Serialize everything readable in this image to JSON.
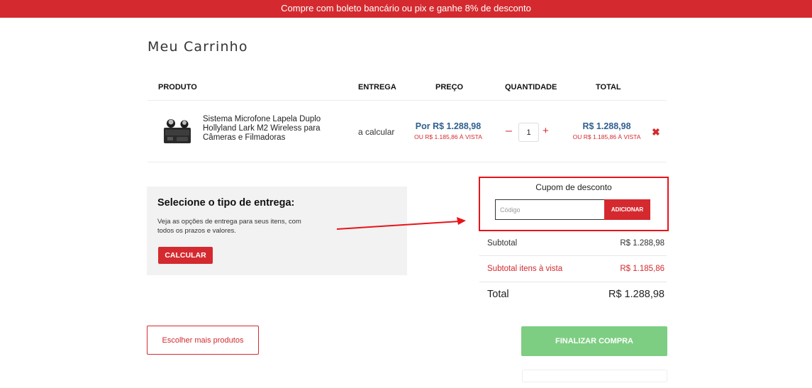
{
  "promo_banner": "Compre com boleto bancário ou pix e ganhe 8% de desconto",
  "page_title": "Meu Carrinho",
  "table": {
    "headers": {
      "product": "PRODUTO",
      "delivery": "ENTREGA",
      "price": "PREÇO",
      "quantity": "QUANTIDADE",
      "total": "TOTAL"
    },
    "items": [
      {
        "name": "Sistema Microfone Lapela Duplo Hollyland Lark M2 Wireless para Câmeras e Filmadoras",
        "delivery": "a calcular",
        "price": "Por R$ 1.288,98",
        "price_cash": "OU R$ 1.185,86 À VISTA",
        "quantity": "1",
        "total": "R$ 1.288,98",
        "total_cash": "OU R$ 1.185,86 À VISTA"
      }
    ],
    "qty_minus": "–",
    "qty_plus": "+",
    "remove": "✖"
  },
  "shipping": {
    "title": "Selecione o tipo de entrega:",
    "description": "Veja as opções de entrega para seus itens, com todos os prazos e valores.",
    "button": "CALCULAR"
  },
  "coupon": {
    "title": "Cupom de desconto",
    "placeholder": "Código",
    "button": "ADICIONAR"
  },
  "summary": {
    "subtotal_label": "Subtotal",
    "subtotal_value": "R$ 1.288,98",
    "cash_label": "Subtotal itens à vista",
    "cash_value": "R$ 1.185,86",
    "total_label": "Total",
    "total_value": "R$ 1.288,98"
  },
  "actions": {
    "more_products": "Escolher mais produtos",
    "checkout": "FINALIZAR COMPRA"
  },
  "colors": {
    "brand_red": "#d42a2f",
    "price_blue": "#2f5f8f",
    "checkout_green": "#7dce82",
    "annotation_red": "#e8141a"
  }
}
